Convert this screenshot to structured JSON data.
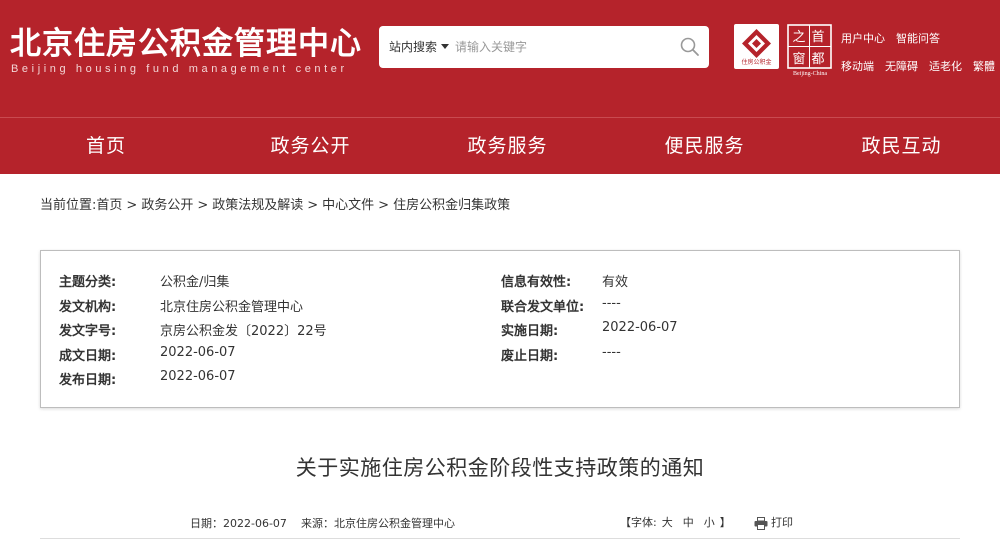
{
  "header": {
    "title": "北京住房公积金管理中心",
    "subtitle": "Beijing housing fund management center",
    "brand_color": "#b5232b",
    "search": {
      "scope_label": "站内搜索",
      "placeholder": "请输入关键字",
      "icon": "search-icon"
    },
    "logo1_caption": "住房公积金",
    "logo2_chars": [
      "首",
      "都",
      "之",
      "窗"
    ],
    "logo2_caption": "Beijing-China",
    "links_row1": [
      "用户中心",
      "智能问答"
    ],
    "links_row2": [
      "移动端",
      "无障碍",
      "适老化",
      "繁體"
    ]
  },
  "nav": {
    "items": [
      "首页",
      "政务公开",
      "政务服务",
      "便民服务",
      "政民互动"
    ]
  },
  "breadcrumb": {
    "prefix": "当前位置:",
    "items": [
      "首页",
      "政务公开",
      "政策法规及解读",
      "中心文件",
      "住房公积金归集政策"
    ],
    "separator": ">"
  },
  "info": {
    "subject_label": "主题分类:",
    "subject_value": "公积金/归集",
    "issuer_label": "发文机构:",
    "issuer_value": "北京住房公积金管理中心",
    "doc_no_label": "发文字号:",
    "doc_no_value": "京房公积金发〔2022〕22号",
    "created_label": "成文日期:",
    "created_value": "2022-06-07",
    "published_label": "发布日期:",
    "published_value": "2022-06-07",
    "validity_label": "信息有效性:",
    "validity_value": "有效",
    "joint_label": "联合发文单位:",
    "joint_value": "----",
    "effective_label": "实施日期:",
    "effective_value": "2022-06-07",
    "abolished_label": "废止日期:",
    "abolished_value": "----"
  },
  "article": {
    "title": "关于实施住房公积金阶段性支持政策的通知",
    "date_text": "日期：2022-06-07",
    "source_text": "来源：北京住房公积金管理中心",
    "font_prefix": "【字体:",
    "font_large": "大",
    "font_medium": "中",
    "font_small": "小",
    "font_suffix": "】",
    "print_label": "打印"
  }
}
